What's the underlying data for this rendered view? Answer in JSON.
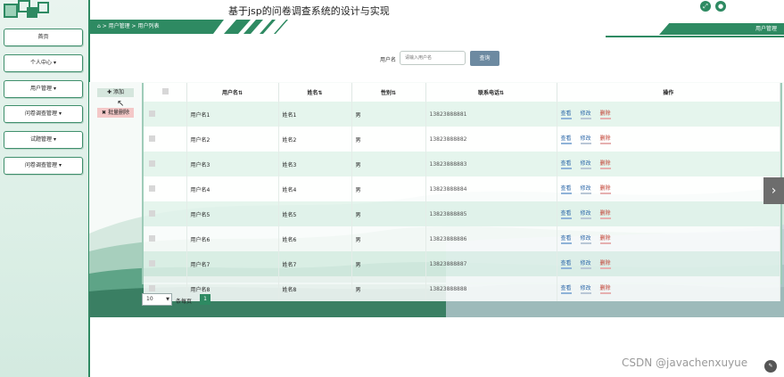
{
  "header": {
    "title": "基于jsp的问卷调查系统的设计与实现",
    "breadcrumb": "⌂ > 用户管理 > 用户列表",
    "right_label": "用户管理",
    "icons": [
      "fullscreen-icon",
      "user-icon"
    ]
  },
  "sidebar": {
    "items": [
      {
        "label": "首页"
      },
      {
        "label": "个人中心 ▾"
      },
      {
        "label": "用户管理 ▾"
      },
      {
        "label": "问卷调查管理 ▾"
      },
      {
        "label": "试题管理 ▾"
      },
      {
        "label": "问卷调查管理 ▾"
      }
    ]
  },
  "search": {
    "label": "用户名",
    "placeholder": "请输入用户名",
    "button": "查询"
  },
  "actions": {
    "add": "✚ 添加",
    "batch_delete": "✖ 批量删除"
  },
  "table": {
    "columns": [
      "",
      "用户名⇅",
      "姓名⇅",
      "性别⇅",
      "联系电话⇅",
      "操作"
    ],
    "rows": [
      {
        "username": "用户名1",
        "name": "姓名1",
        "gender": "男",
        "phone": "13823888881"
      },
      {
        "username": "用户名2",
        "name": "姓名2",
        "gender": "男",
        "phone": "13823888882"
      },
      {
        "username": "用户名3",
        "name": "姓名3",
        "gender": "男",
        "phone": "13823888883"
      },
      {
        "username": "用户名4",
        "name": "姓名4",
        "gender": "男",
        "phone": "13823888884"
      },
      {
        "username": "用户名5",
        "name": "姓名5",
        "gender": "男",
        "phone": "13823888885"
      },
      {
        "username": "用户名6",
        "name": "姓名6",
        "gender": "男",
        "phone": "13823888886"
      },
      {
        "username": "用户名7",
        "name": "姓名7",
        "gender": "男",
        "phone": "13823888887"
      },
      {
        "username": "用户名8",
        "name": "姓名8",
        "gender": "男",
        "phone": "13823888888"
      }
    ],
    "row_actions": {
      "view": "查看",
      "edit": "修改",
      "delete": "删除"
    }
  },
  "pagination": {
    "page_size": "10",
    "per_page_label": "条每页",
    "current_page": "1"
  },
  "watermark": "CSDN @javachenxuyue",
  "colors": {
    "primary": "#2e8a62",
    "search_button": "#6d8aa1",
    "delete_bg": "#f4c8c8",
    "add_bg": "#d5e6dd"
  }
}
